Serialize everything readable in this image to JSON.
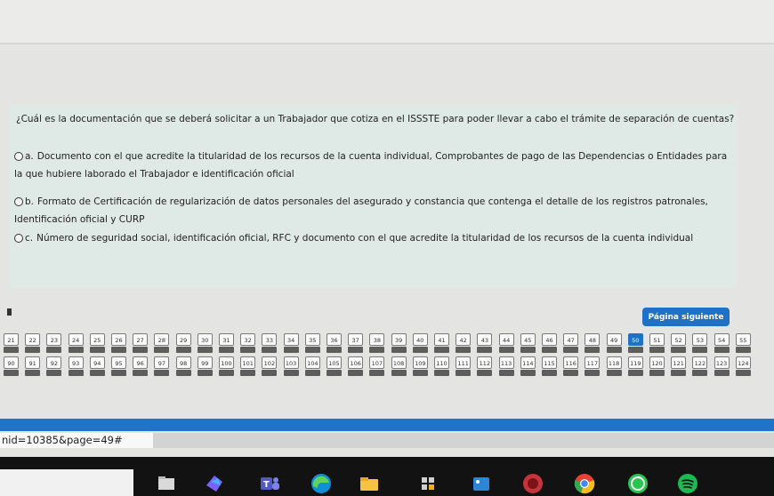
{
  "question": "¿Cuál es la documentación que se deberá solicitar a un Trabajador que cotiza en el ISSSTE para poder llevar a cabo el trámite de separación de cuentas?",
  "options": [
    {
      "letter": "a.",
      "text": "Documento con el que acredite la titularidad de los recursos de la cuenta individual, Comprobantes de pago de las Dependencias o Entidades para la que hubiere laborado el Trabajador e identificación oficial"
    },
    {
      "letter": "b.",
      "text": "Formato de Certificación de regularización de datos personales del asegurado y constancia que contenga el detalle de los registros patronales, Identificación oficial y CURP"
    },
    {
      "letter": "c.",
      "text": "Número de seguridad social, identificación oficial, RFC y documento con el que acredite la titularidad de los recursos de la cuenta individual"
    }
  ],
  "next_button": "Página siguiente",
  "pages_row1": [
    "21",
    "22",
    "23",
    "24",
    "25",
    "26",
    "27",
    "28",
    "29",
    "30",
    "31",
    "32",
    "33",
    "34",
    "35",
    "36",
    "37",
    "38",
    "39",
    "40",
    "41",
    "42",
    "43",
    "44",
    "45",
    "46",
    "47",
    "48",
    "49",
    "50",
    "51",
    "52",
    "53",
    "54",
    "55"
  ],
  "pages_row2": [
    "90",
    "91",
    "92",
    "93",
    "94",
    "95",
    "96",
    "97",
    "98",
    "99",
    "100",
    "101",
    "102",
    "103",
    "104",
    "105",
    "106",
    "107",
    "108",
    "109",
    "110",
    "111",
    "112",
    "113",
    "114",
    "115",
    "116",
    "117",
    "118",
    "119",
    "120",
    "121",
    "122",
    "123",
    "124"
  ],
  "current_page": "50",
  "url_text": "nid=10385&page=49#",
  "taskbar_icons": [
    "file-explorer-icon",
    "paint-icon",
    "teams-icon",
    "edge-icon",
    "folder-icon",
    "calculator-icon",
    "store-icon",
    "game-icon",
    "chrome-icon",
    "whatsapp-icon",
    "spotify-icon"
  ]
}
